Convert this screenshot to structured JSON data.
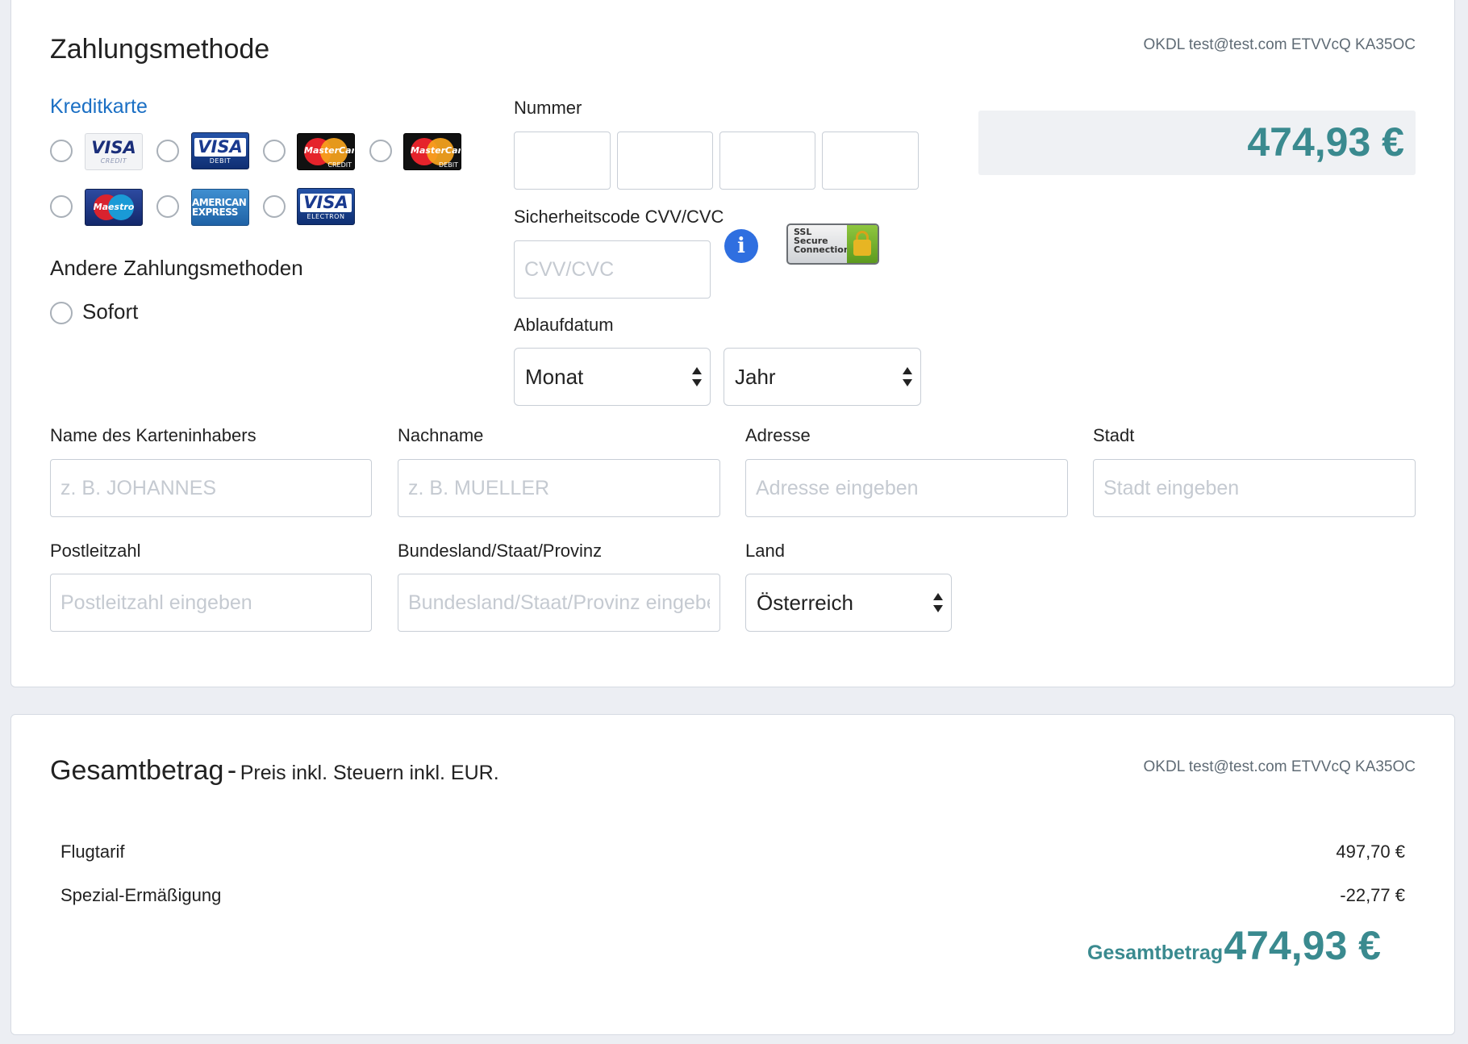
{
  "payment": {
    "title": "Zahlungsmethode",
    "meta": "OKDL test@test.com ETVVcQ KA35OC",
    "credit_card_label": "Kreditkarte",
    "cards": [
      {
        "name": "visa-credit",
        "big": "VISA",
        "small": "CREDIT"
      },
      {
        "name": "visa-debit",
        "big": "VISA",
        "small": "DEBIT"
      },
      {
        "name": "mastercard-credit",
        "big": "MasterCard",
        "small": "CREDIT"
      },
      {
        "name": "mastercard-debit",
        "big": "MasterCard",
        "small": "DEBIT"
      },
      {
        "name": "maestro",
        "big": "Maestro",
        "small": ""
      },
      {
        "name": "american-express",
        "big": "AMERICAN EXPRESS",
        "small": ""
      },
      {
        "name": "visa-electron",
        "big": "VISA",
        "small": "ELECTRON"
      }
    ],
    "other_methods_label": "Andere Zahlungsmethoden",
    "sofort_label": "Sofort",
    "number_label": "Nummer",
    "cvv_label": "Sicherheitscode CVV/CVC",
    "cvv_placeholder": "CVV/CVC",
    "expiry_label": "Ablaufdatum",
    "month_value": "Monat",
    "year_value": "Jahr",
    "amount": "474,93 €",
    "ssl_text": [
      "SSL",
      "Secure",
      "Connection"
    ],
    "holder_label": "Name des Karteninhabers",
    "holder_placeholder": "z. B. JOHANNES",
    "lastname_label": "Nachname",
    "lastname_placeholder": "z. B. MUELLER",
    "address_label": "Adresse",
    "address_placeholder": "Adresse eingeben",
    "city_label": "Stadt",
    "city_placeholder": "Stadt eingeben",
    "zip_label": "Postleitzahl",
    "zip_placeholder": "Postleitzahl eingeben",
    "state_label": "Bundesland/Staat/Provinz",
    "state_placeholder": "Bundesland/Staat/Provinz eingeben",
    "country_label": "Land",
    "country_value": "Österreich"
  },
  "summary": {
    "title": "Gesamtbetrag",
    "dash": "-",
    "subtitle": "Preis inkl. Steuern inkl. EUR.",
    "meta": "OKDL test@test.com ETVVcQ KA35OC",
    "rows": [
      {
        "label": "Flugtarif",
        "value": "497,70 €"
      },
      {
        "label": "Spezial-Ermäßigung",
        "value": "-22,77 €"
      }
    ],
    "total_label": "Gesamtbetrag",
    "total_value": "474,93 €"
  },
  "colors": {
    "accent_teal": "#3a8a8f",
    "link_blue": "#1a6fc4",
    "info_blue": "#2f6fe0"
  }
}
